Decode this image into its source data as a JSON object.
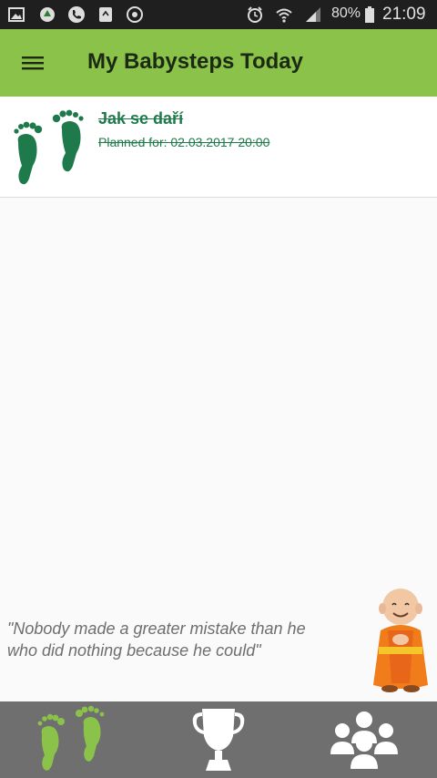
{
  "status_bar": {
    "battery_percent": "80%",
    "time": "21:09",
    "icons": [
      "image-icon",
      "app-icon",
      "phone-icon",
      "recycle-icon",
      "sync-icon",
      "alarm-icon",
      "wifi-icon",
      "signal-icon",
      "battery-icon"
    ]
  },
  "app_bar": {
    "title": "My Babysteps Today",
    "color": "#8bc34a"
  },
  "steps": [
    {
      "title": "Jak se daří",
      "subtitle": "Planned for: 02.03.2017 20:00",
      "icon": "footprints-icon",
      "completed": true,
      "color": "#1e7a4a"
    }
  ],
  "quote": {
    "line1": "\"Nobody made a greater mistake than he",
    "line2": "who did nothing because he could\""
  },
  "bottom_nav": {
    "items": [
      {
        "icon": "footprints-icon",
        "active": true
      },
      {
        "icon": "trophy-icon",
        "active": false
      },
      {
        "icon": "community-icon",
        "active": false
      }
    ],
    "active_color": "#8bc34a",
    "inactive_color": "#ffffff",
    "background": "#6f6f6f"
  }
}
